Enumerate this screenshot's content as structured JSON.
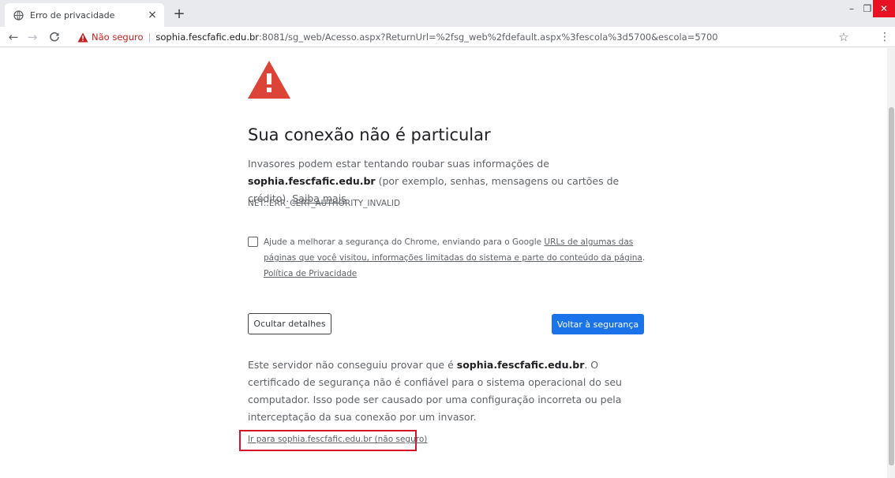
{
  "tab": {
    "title": "Erro de privacidade",
    "close_glyph": "×",
    "new_tab_glyph": "+"
  },
  "window": {
    "minimize_glyph": "–",
    "maximize_glyph": "❐",
    "close_glyph": "✕",
    "close_color": "#e81123"
  },
  "toolbar": {
    "back_glyph": "←",
    "forward_glyph": "→",
    "reload_glyph": "C",
    "security_label": "Não seguro",
    "separator": "|",
    "url_host": "sophia.fescfafic.edu.br",
    "url_rest": ":8081/sg_web/Acesso.aspx?ReturnUrl=%2fsg_web%2fdefault.aspx%3fescola%3d5700&escola=5700",
    "star_glyph": "☆",
    "menu_glyph": "⋮"
  },
  "interstitial": {
    "danger_color": "#db4437",
    "heading": "Sua conexão não é particular",
    "msg_prefix": "Invasores podem estar tentando roubar suas informações de ",
    "msg_host": "sophia.fescfafic.edu.br",
    "msg_suffix": " (por exemplo, senhas, mensagens ou cartões de crédito). ",
    "learn_more": "Saiba mais",
    "error_code": "NET::ERR_CERT_AUTHORITY_INVALID",
    "optin_prefix": "Ajude a melhorar a segurança do Chrome, enviando para o Google ",
    "optin_link": "URLs de algumas das páginas que você visitou, informações limitadas do sistema e parte do conteúdo da página",
    "optin_sep": ". ",
    "privacy_link": "Política de Privacidade",
    "details_button": "Ocultar detalhes",
    "back_button": "Voltar à segurança",
    "back_button_color": "#1a73e8",
    "details_prefix": "Este servidor não conseguiu provar que é ",
    "details_host": "sophia.fescfafic.edu.br",
    "details_suffix": ". O certificado de segurança não é confiável para o sistema operacional do seu computador. Isso pode ser causado por uma configuração incorreta ou pela interceptação da sua conexão por um invasor.",
    "proceed_link": "Ir para sophia.fescfafic.edu.br (não seguro)",
    "highlight_color": "#d5152b"
  }
}
